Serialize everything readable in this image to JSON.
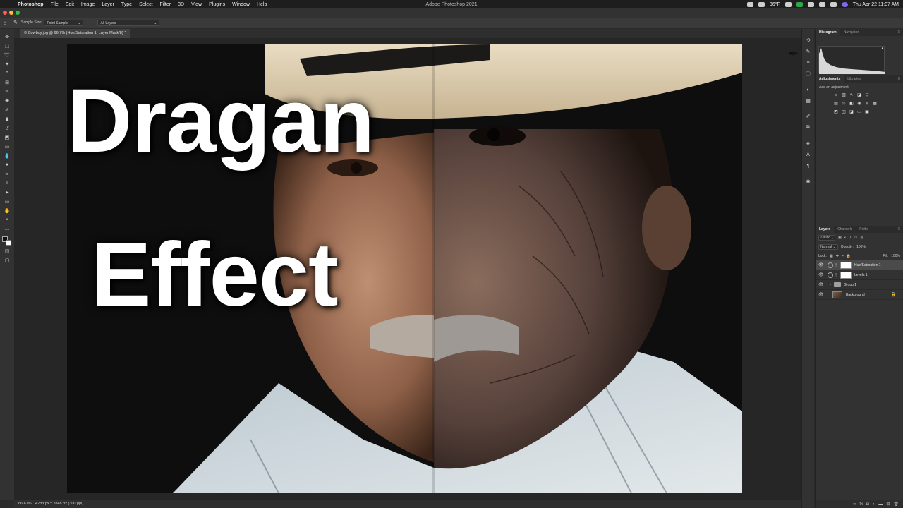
{
  "menubar": {
    "items": [
      "Photoshop",
      "File",
      "Edit",
      "Image",
      "Layer",
      "Type",
      "Select",
      "Filter",
      "3D",
      "View",
      "Plugins",
      "Window",
      "Help"
    ],
    "window_title": "Adobe Photoshop 2021",
    "temperature": "36°F",
    "datetime": "Thu Apr 22  11:07 AM"
  },
  "options_bar": {
    "sample_size_label": "Sample Size:",
    "sample_size_value": "Point Sample",
    "layers_value": "All Layers"
  },
  "document": {
    "tab_title": "© Cowboy.jpg @ 66.7% (Hue/Saturation 1, Layer Mask/8) *"
  },
  "overlay": {
    "line1": "Dragan",
    "line2": "Effect"
  },
  "status": {
    "zoom": "66.67%",
    "doc_info": "4288 px x 2848 px (300 ppi)"
  },
  "panels": {
    "histogram_tab": "Histogram",
    "navigator_tab": "Navigator",
    "adjustments_tab": "Adjustments",
    "libraries_tab": "Libraries",
    "add_adjustment": "Add an adjustment",
    "layers_tab": "Layers",
    "channels_tab": "Channels",
    "paths_tab": "Paths",
    "kind_filter": "Kind",
    "blend_mode": "Normal",
    "opacity_label": "Opacity:",
    "opacity_value": "100%",
    "lock_label": "Lock:",
    "fill_label": "Fill:",
    "fill_value": "100%"
  },
  "layers": [
    {
      "name": "Hue/Saturation 1",
      "type": "adjustment",
      "selected": true
    },
    {
      "name": "Levels 1",
      "type": "adjustment",
      "selected": false
    },
    {
      "name": "Group 1",
      "type": "group",
      "selected": false
    },
    {
      "name": "Background",
      "type": "image",
      "selected": false
    }
  ]
}
